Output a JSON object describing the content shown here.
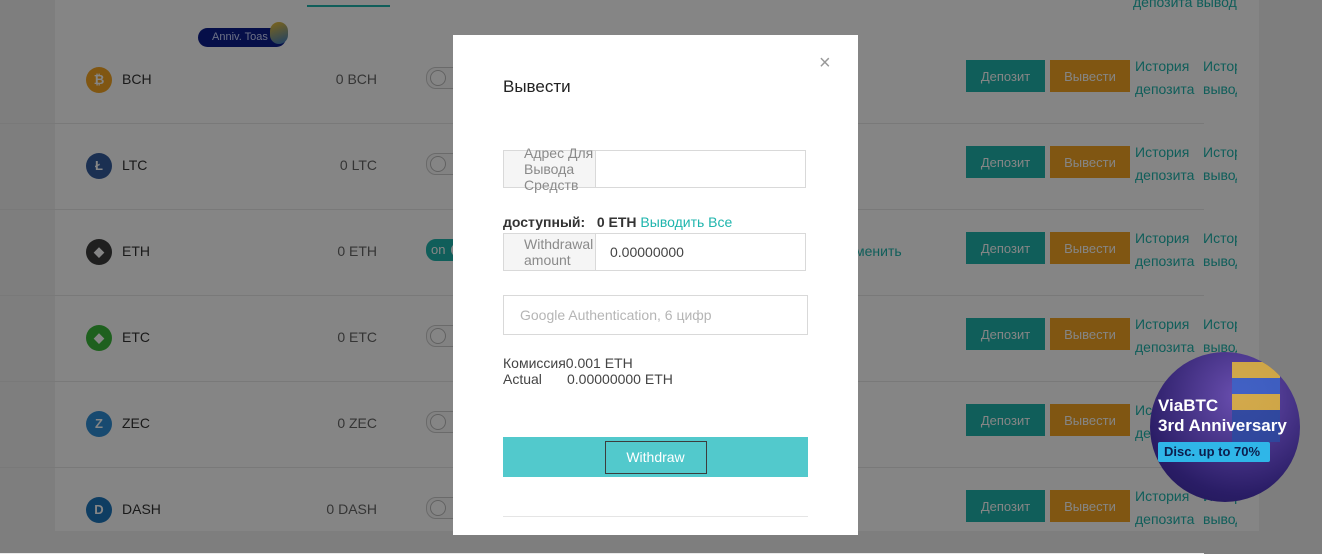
{
  "background": {
    "badge_label": "Anniv. Toas",
    "rows": [
      {
        "symbol": "BCH",
        "balance": "0 BCH",
        "icon": "bch-coin-icon",
        "color": "#f5a623",
        "glyph": "₿",
        "toggle": "off",
        "deposit": "Депозит",
        "withdraw": "Вывести",
        "hist1": "История",
        "hist2": "депозита",
        "hist3": "Истор",
        "hist4": "вывод"
      },
      {
        "symbol": "LTC",
        "balance": "0 LTC",
        "icon": "ltc-coin-icon",
        "color": "#345d9d",
        "glyph": "Ł",
        "toggle": "off",
        "deposit": "Депозит",
        "withdraw": "Вывести",
        "hist1": "История",
        "hist2": "депозита",
        "hist3": "Истор",
        "hist4": "вывод"
      },
      {
        "symbol": "ETH",
        "balance": "0 ETH",
        "icon": "eth-coin-icon",
        "color": "#3c3c3d",
        "glyph": "◆",
        "toggle": "on",
        "toggle_text": "on",
        "change": "менить",
        "deposit": "Депозит",
        "withdraw": "Вывести",
        "hist1": "История",
        "hist2": "депозита",
        "hist3": "Истор",
        "hist4": "вывод"
      },
      {
        "symbol": "ETC",
        "balance": "0 ETC",
        "icon": "etc-coin-icon",
        "color": "#3ab83a",
        "glyph": "◆",
        "toggle": "off",
        "deposit": "Депозит",
        "withdraw": "Вывести",
        "hist1": "История",
        "hist2": "депозита",
        "hist3": "Истор",
        "hist4": "вывод"
      },
      {
        "symbol": "ZEC",
        "balance": "0 ZEC",
        "icon": "zec-coin-icon",
        "color": "#2f8fd6",
        "glyph": "Z",
        "toggle": "off",
        "deposit": "Депозит",
        "withdraw": "Вывести",
        "hist1": "История",
        "hist2": "депозита",
        "hist3": "Истор",
        "hist4": "вывод"
      },
      {
        "symbol": "DASH",
        "balance": "0 DASH",
        "icon": "dash-coin-icon",
        "color": "#1c75bc",
        "glyph": "D",
        "toggle": "off",
        "deposit": "Депозит",
        "withdraw": "Вывести",
        "hist1": "История",
        "hist2": "депозита",
        "hist3": "Истор",
        "hist4": "вывод"
      }
    ],
    "top_link": "депозита вывод"
  },
  "promo": {
    "line1": "ViaBTC",
    "line2": "3rd Anniversary",
    "discount": "Disc. up to 70%"
  },
  "modal": {
    "title": "Вывести",
    "close_glyph": "×",
    "address_label": "Адрес Для Вывода Средств",
    "address_value": "",
    "available_label": "доступный:",
    "available_amount": "0 ETH",
    "withdraw_all": "Выводить Все",
    "amount_label": "Withdrawal amount",
    "amount_value": "0.00000000",
    "ga_placeholder": "Google Authentication, 6 цифр",
    "fee_label": "Комиссия",
    "fee_value": "0.001 ETH",
    "actual_label": "Actual",
    "actual_value": "0.00000000 ETH",
    "submit_label": "Withdraw"
  },
  "colors": {
    "accent": "#1fb5ad",
    "withdraw_orange": "#f5a623",
    "submit_button": "#52c9cc"
  }
}
